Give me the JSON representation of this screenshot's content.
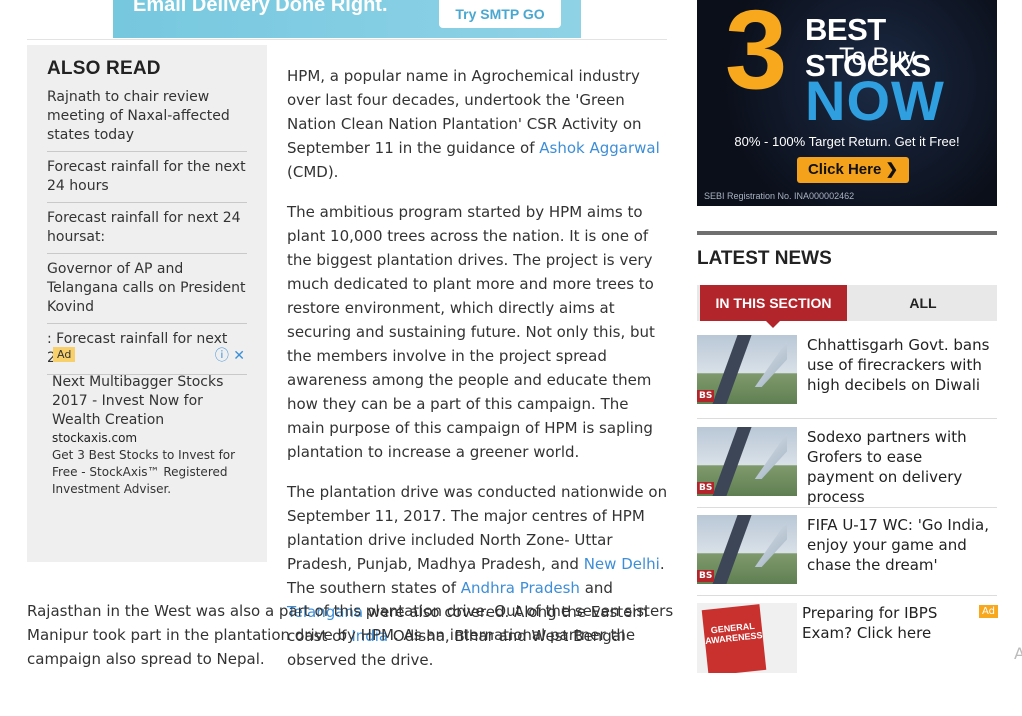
{
  "top_banner": {
    "text": "Email Delivery Done Right.",
    "button_label": "Try SMTP GO Free"
  },
  "also_read": {
    "heading": "ALSO READ",
    "items": [
      "Rajnath to chair review meeting of Naxal-affected states today",
      "Forecast rainfall for the next 24 hours",
      "Forecast rainfall for next 24 hoursat:",
      "Governor of AP and Telangana calls on President Kovind",
      ": Forecast rainfall for next 24"
    ],
    "ad": {
      "badge": "Ad",
      "icons": "ⓘ ✕",
      "title": "Next Multibagger Stocks 2017 - Invest Now for Wealth Creation",
      "domain": "stockaxis.com",
      "description": "Get 3 Best Stocks to Invest for Free - StockAxis™ Registered Investment Adviser."
    }
  },
  "article": {
    "p1_a": "HPM, a popular name in Agrochemical industry over last four decades, undertook the 'Green Nation Clean Nation Plantation' CSR Activity on September 11 in the guidance of ",
    "p1_link": "Ashok Aggarwal",
    "p1_b": " (CMD).",
    "p2": "The ambitious program started by HPM aims to plant 10,000 trees across the nation. It is one of the biggest plantation drives. The project is very much dedicated to plant more and more trees to restore environment, which directly aims at securing and sustaining future. Not only this, but the members involve in the project spread awareness among the people and educate them how they can be a part of this campaign. The main purpose of this campaign of HPM is sapling plantation to increase a greener world.",
    "p3_a": "The plantation drive was conducted nationwide on September 11, 2017. The major centres of HPM plantation drive included North Zone- Uttar Pradesh, Punjab, Madhya Pradesh, and ",
    "p3_link1": "New Delhi",
    "p3_b": ". The southern states of ",
    "p3_link2": "Andhra Pradesh",
    "p3_c": " and ",
    "p3_link3": "Telangana",
    "p3_d": " were also covered. Along the Eastern coast of ",
    "p3_link4": "India",
    "p3_e": " Odisha, Bihar and West Bengal observed the drive.",
    "tail": "Rajasthan in the West was also a part of this plantation drive. Out of the seven sisters Manipur took part in the plantation drive by HPM. As an international partner the campaign also spread to Nepal."
  },
  "right_ad": {
    "number": "3",
    "line1": "BEST STOCKS",
    "line2": "To Buy",
    "line3": "NOW",
    "line4": "80% - 100% Target Return. Get it Free!",
    "cta": "Click Here ❯",
    "sebi": "SEBI Registration No. INA000002462"
  },
  "latest_news": {
    "title": "LATEST NEWS",
    "tabs": [
      "IN THIS SECTION",
      "ALL"
    ],
    "items": [
      {
        "title": "Chhattisgarh Govt. bans use of firecrackers with high decibels on Diwali",
        "badge": "BS"
      },
      {
        "title": "Sodexo partners with Grofers to ease payment on delivery process",
        "badge": "BS"
      },
      {
        "title": "FIFA U-17 WC: 'Go India, enjoy your game and chase the dream'",
        "badge": "BS"
      }
    ],
    "ad_item": {
      "title": "Preparing for IBPS Exam? Click here",
      "tag": "Ad",
      "book_text": "GENERAL AWARENESS"
    }
  },
  "edge_glyph": "A"
}
